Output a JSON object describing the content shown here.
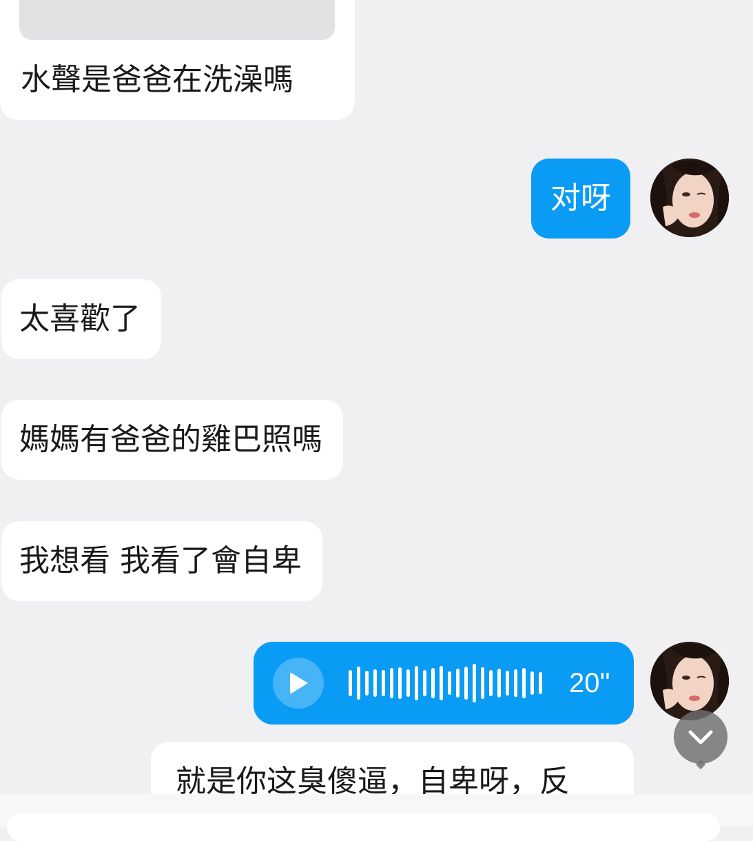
{
  "messages": [
    {
      "id": "m1",
      "side": "incoming",
      "type": "image+text",
      "text": "水聲是爸爸在洗澡嗎"
    },
    {
      "id": "m2",
      "side": "outgoing",
      "type": "text",
      "text": "对呀"
    },
    {
      "id": "m3",
      "side": "incoming",
      "type": "text",
      "text": "太喜歡了"
    },
    {
      "id": "m4",
      "side": "incoming",
      "type": "text",
      "text": "媽媽有爸爸的雞巴照嗎"
    },
    {
      "id": "m5",
      "side": "incoming",
      "type": "text",
      "text": "我想看 我看了會自卑"
    },
    {
      "id": "m6",
      "side": "outgoing",
      "type": "voice",
      "duration": "20''"
    },
    {
      "id": "m7",
      "side": "outgoing",
      "type": "text",
      "text": "就是你这臭傻逼，自卑呀，反"
    }
  ],
  "icons": {
    "play": "play-icon",
    "scroll_down": "chevron-down-icon"
  },
  "colors": {
    "background": "#f0f0f2",
    "incoming_bubble": "#ffffff",
    "outgoing_bubble": "#0a9bf5"
  }
}
